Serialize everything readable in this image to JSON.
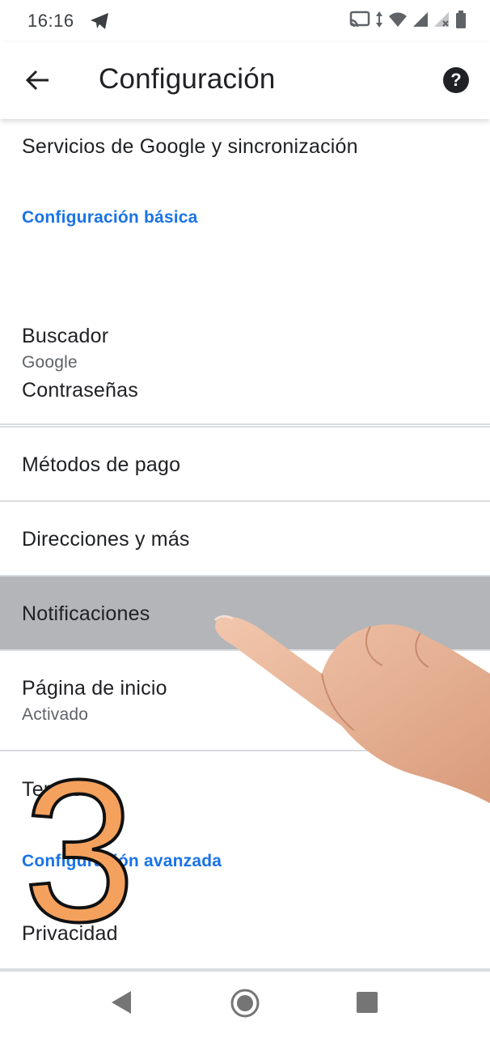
{
  "status_bar": {
    "time": "16:16"
  },
  "app_bar": {
    "title": "Configuración",
    "help_label": "?"
  },
  "rows": {
    "google_services": "Servicios de Google y sincronización",
    "section_basic": "Configuración básica",
    "search_engine_title": "Buscador",
    "search_engine_value": "Google",
    "passwords": "Contraseñas",
    "payment_methods": "Métodos de pago",
    "addresses": "Direcciones y más",
    "notifications": "Notificaciones",
    "homepage_title": "Página de inicio",
    "homepage_value": "Activado",
    "themes": "Temas",
    "section_advanced": "Configuración avanzada",
    "privacy": "Privacidad"
  },
  "overlay": {
    "step_number": "3"
  },
  "colors": {
    "accent": "#1a73e8",
    "highlight": "#b3b5b8",
    "step_fill": "#f4a15e"
  }
}
